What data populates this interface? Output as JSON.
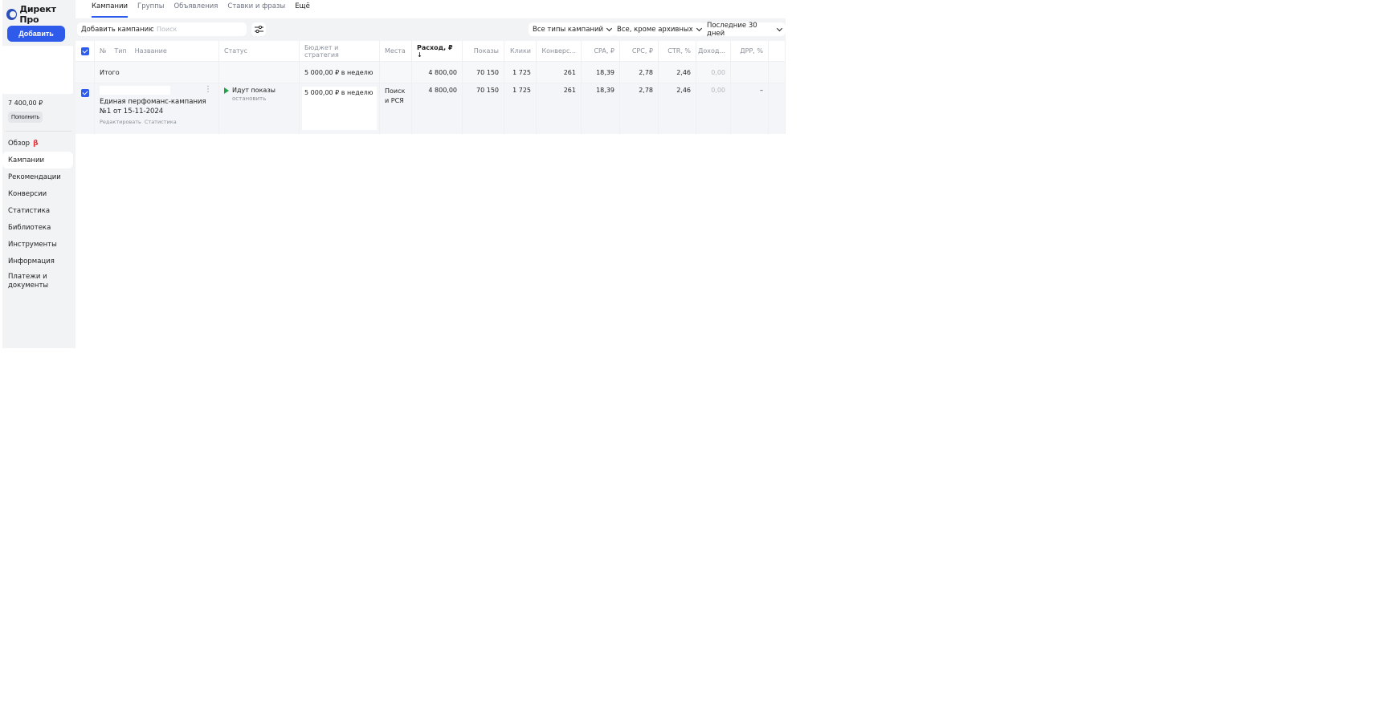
{
  "sidebar": {
    "logo_text": "Директ Про",
    "add_button": "Добавить",
    "balance": "7 400,00 ₽",
    "topup_button": "Пополнить",
    "nav": [
      {
        "label": "Обзор",
        "badge": "β"
      },
      {
        "label": "Кампании"
      },
      {
        "label": "Рекомендации"
      },
      {
        "label": "Конверсии"
      },
      {
        "label": "Статистика"
      },
      {
        "label": "Библиотека"
      },
      {
        "label": "Инструменты"
      },
      {
        "label": "Информация"
      },
      {
        "label": "Платежи и документы"
      }
    ]
  },
  "tabs": [
    "Кампании",
    "Группы",
    "Объявления",
    "Ставки и фразы",
    "Ещё"
  ],
  "toolbar": {
    "add_campaign": "Добавить кампанию",
    "search_placeholder": "Поиск",
    "filter_type": "Все типы кампаний",
    "filter_archive": "Все, кроме архивных",
    "filter_period": "Последние 30 дней"
  },
  "table": {
    "headers": {
      "num": "№",
      "type": "Тип",
      "name": "Название",
      "status": "Статус",
      "budget": "Бюджет и стратегия",
      "places": "Места",
      "spend": "Расход, ₽ ↓",
      "impressions": "Показы",
      "clicks": "Клики",
      "conversions": "Конверс...",
      "cpa": "CPA, ₽",
      "cpc": "CPC, ₽",
      "ctr": "CTR, %",
      "revenue": "Доход...",
      "drr": "ДРР, %"
    },
    "total": {
      "label": "Итого",
      "budget": "5 000,00 ₽ в неделю",
      "spend": "4 800,00",
      "impressions": "70 150",
      "clicks": "1 725",
      "conversions": "261",
      "cpa": "18,39",
      "cpc": "2,78",
      "ctr": "2,46",
      "revenue": "0,00"
    },
    "rows": [
      {
        "name": "Единая перфоманс-кампания №1 от 15-11-2024",
        "edit_link": "Редактировать",
        "stats_link": "Статистика",
        "status": "Идут показы",
        "status_action": "остановить",
        "budget": "5 000,00 ₽ в неделю",
        "places": "Поиск и РСЯ",
        "spend": "4 800,00",
        "impressions": "70 150",
        "clicks": "1 725",
        "conversions": "261",
        "cpa": "18,39",
        "cpc": "2,78",
        "ctr": "2,46",
        "revenue": "0,00",
        "drr": "–"
      }
    ]
  },
  "colors": {
    "accent": "#2f5bea",
    "status_active": "#1fa34a",
    "beta": "#e0323a"
  }
}
